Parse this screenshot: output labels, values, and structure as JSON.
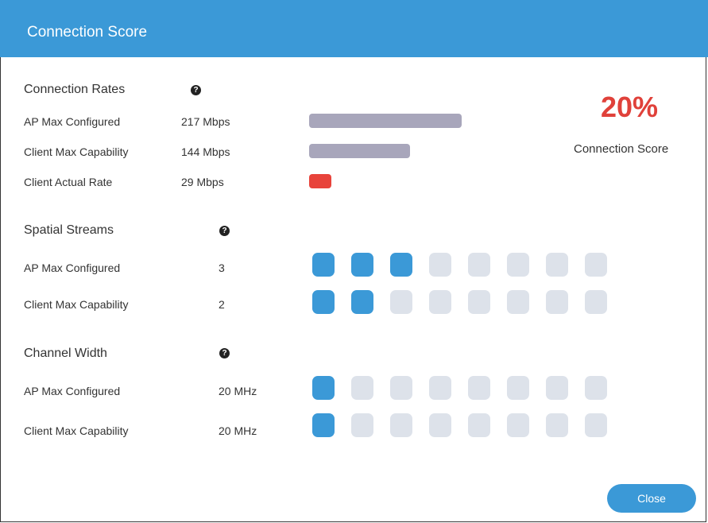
{
  "dialog": {
    "title": "Connection Score",
    "close_label": "Close"
  },
  "colors": {
    "title_bar": "#3b99d7",
    "bar_neutral": "#a8a6bb",
    "bar_actual": "#e8433b",
    "stream_on": "#3b99d7",
    "stream_off": "#dde2ea",
    "score_text": "#e0413a"
  },
  "score": {
    "value": "20%",
    "label": "Connection Score"
  },
  "connection_rates": {
    "heading": "Connection Rates",
    "help_icon": "question-circle-icon",
    "rows": [
      {
        "label": "AP Max Configured",
        "value": "217 Mbps",
        "color": "#a8a6bb",
        "mbps": 217
      },
      {
        "label": "Client Max Capability",
        "value": "144 Mbps",
        "color": "#a8a6bb",
        "mbps": 144
      },
      {
        "label": "Client Actual Rate",
        "value": "29 Mbps",
        "color": "#e8433b",
        "mbps": 29
      }
    ]
  },
  "spatial_streams": {
    "heading": "Spatial Streams",
    "help_icon": "question-circle-icon",
    "total": 8,
    "rows": [
      {
        "label": "AP Max Configured",
        "value": "3",
        "filled": 3
      },
      {
        "label": "Client Max Capability",
        "value": "2",
        "filled": 2
      }
    ]
  },
  "channel_width": {
    "heading": "Channel Width",
    "help_icon": "question-circle-icon",
    "total": 8,
    "rows": [
      {
        "label": "AP Max Configured",
        "value": "20 MHz",
        "filled": 1
      },
      {
        "label": "Client Max Capability",
        "value": "20 MHz",
        "filled": 1
      }
    ]
  }
}
